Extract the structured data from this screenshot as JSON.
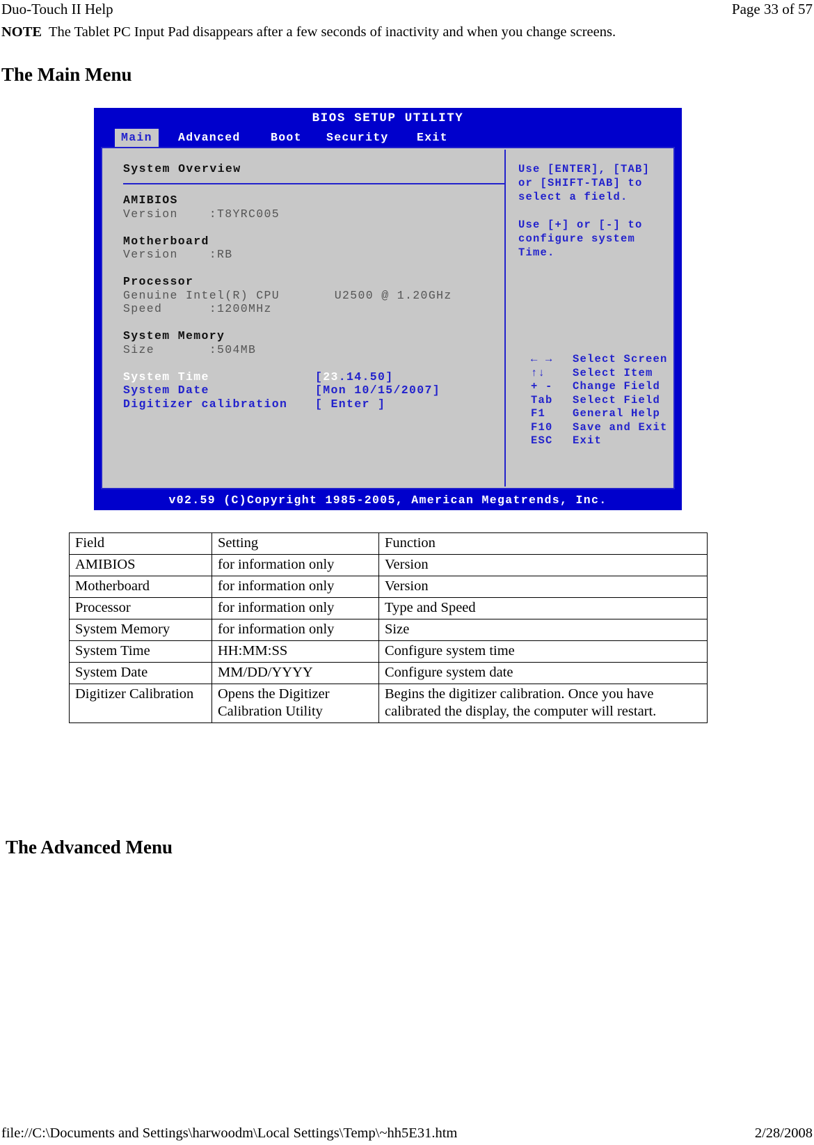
{
  "header": {
    "doc_title": "Duo-Touch II Help",
    "page_indicator": "Page 33 of 57"
  },
  "note": {
    "label": "NOTE",
    "text": "The Tablet PC Input Pad disappears after a few seconds of inactivity and when you change screens."
  },
  "headings": {
    "main_menu": "The Main Menu",
    "advanced_menu": "The Advanced Menu"
  },
  "bios": {
    "title": "BIOS SETUP UTILITY",
    "tabs": [
      {
        "label": "Main",
        "active": true
      },
      {
        "label": "Advanced",
        "active": false
      },
      {
        "label": "Boot",
        "active": false
      },
      {
        "label": "Security",
        "active": false
      },
      {
        "label": "Exit",
        "active": false
      }
    ],
    "panel_title": "System Overview",
    "groups": [
      {
        "name": "AMIBIOS",
        "lines": [
          "Version    :T8YRC005"
        ]
      },
      {
        "name": "Motherboard",
        "lines": [
          "Version    :RB"
        ]
      },
      {
        "name": "Processor",
        "lines": [
          "Genuine Intel(R) CPU       U2500 @ 1.20GHz",
          "Speed      :1200MHz"
        ]
      },
      {
        "name": "System Memory",
        "lines": [
          "Size       :504MB"
        ]
      }
    ],
    "fields": [
      {
        "label": "System Time",
        "selected": true,
        "value_prefix": "[",
        "value_cursor": "23",
        "value_rest": ".14.50]"
      },
      {
        "label": "System Date",
        "selected": false,
        "value": "[Mon 10/15/2007]"
      },
      {
        "label": "Digitizer calibration",
        "selected": false,
        "value": "[ Enter ]"
      }
    ],
    "help_lines": [
      "Use [ENTER], [TAB]",
      "or [SHIFT-TAB] to",
      "select a field.",
      "",
      "Use [+] or [-] to",
      "configure system",
      "Time."
    ],
    "key_legend": [
      {
        "key": "← →",
        "desc": "Select Screen"
      },
      {
        "key": "↑↓",
        "desc": "Select Item"
      },
      {
        "key": "+ -",
        "desc": "Change Field"
      },
      {
        "key": "Tab",
        "desc": "Select Field"
      },
      {
        "key": "F1",
        "desc": "General Help"
      },
      {
        "key": "F10",
        "desc": "Save and Exit"
      },
      {
        "key": "ESC",
        "desc": "Exit"
      }
    ],
    "footer": "v02.59 (C)Copyright 1985-2005, American Megatrends, Inc.",
    "colors": {
      "chrome_blue": "#0000cc",
      "text_blue": "#2222cc",
      "panel_gray": "#c8c8c8",
      "highlight_white": "#ffffff"
    }
  },
  "table": {
    "headers": [
      "Field",
      "Setting",
      "Function"
    ],
    "rows": [
      [
        "AMIBIOS",
        "for information only",
        "Version"
      ],
      [
        "Motherboard",
        "for information only",
        "Version"
      ],
      [
        "Processor",
        "for information only",
        "Type and Speed"
      ],
      [
        "System Memory",
        "for information only",
        "Size"
      ],
      [
        "System Time",
        "HH:MM:SS",
        "Configure system time"
      ],
      [
        "System Date",
        "MM/DD/YYYY",
        "Configure system date"
      ],
      [
        "Digitizer Calibration",
        "Opens the  Digitizer Calibration Utility",
        "Begins the digitizer calibration.  Once you have calibrated the display, the computer will restart."
      ]
    ]
  },
  "footer": {
    "path": "file://C:\\Documents and Settings\\harwoodm\\Local Settings\\Temp\\~hh5E31.htm",
    "date": "2/28/2008"
  }
}
